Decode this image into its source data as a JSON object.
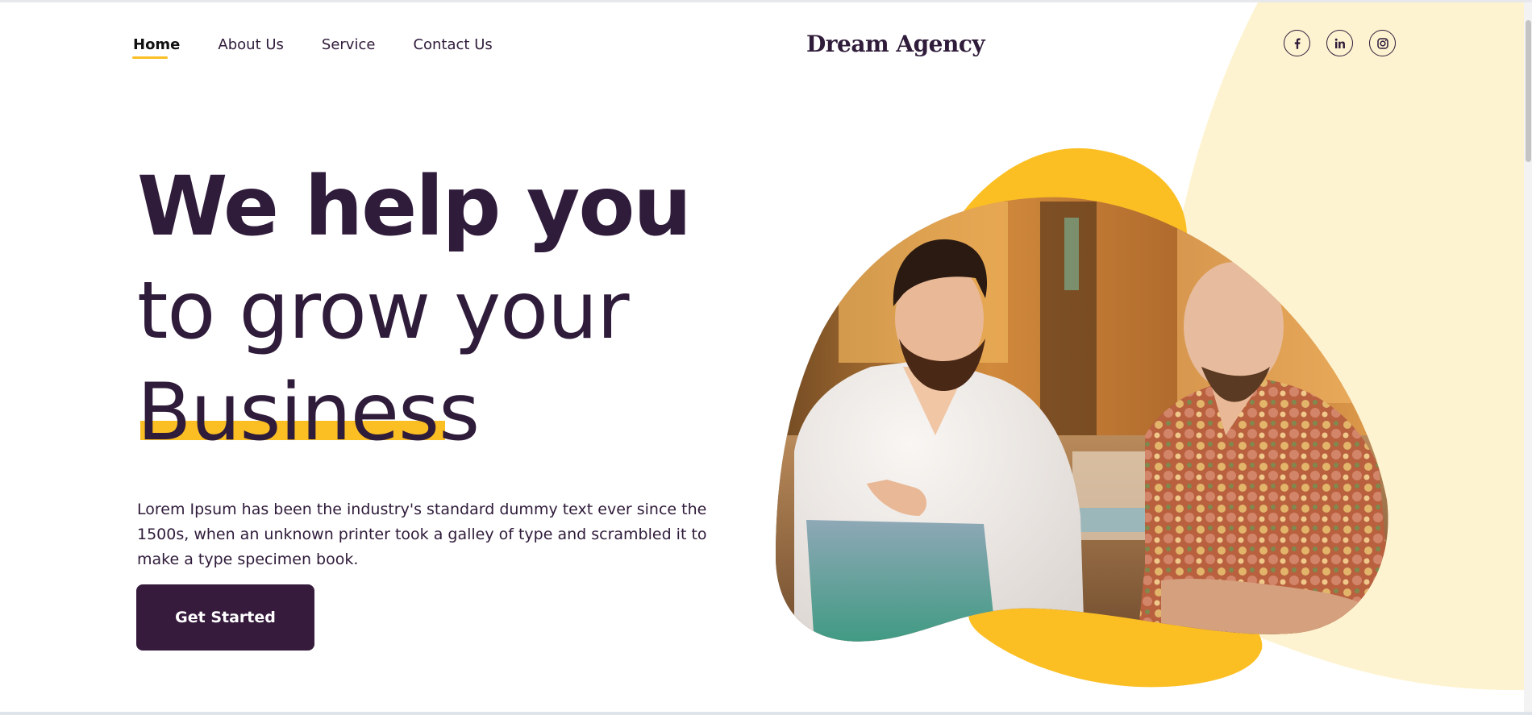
{
  "nav": {
    "items": [
      {
        "label": "Home",
        "active": true
      },
      {
        "label": "About Us",
        "active": false
      },
      {
        "label": "Service",
        "active": false
      },
      {
        "label": "Contact Us",
        "active": false
      }
    ]
  },
  "brand": {
    "name": "Dream Agency"
  },
  "social": [
    {
      "icon": "facebook-icon"
    },
    {
      "icon": "linkedin-icon"
    },
    {
      "icon": "instagram-icon"
    }
  ],
  "hero": {
    "line1": "We help you",
    "line2": "to grow your",
    "line3": "Business",
    "description": "Lorem Ipsum has been the industry's standard dummy text ever since the 1500s, when an unknown printer took a galley of type and scrambled it to make a type specimen book.",
    "cta_label": "Get Started"
  },
  "colors": {
    "primary": "#361b3d",
    "accent": "#fbbf24",
    "cream": "#fef3d0",
    "text": "#2f1b3a"
  }
}
